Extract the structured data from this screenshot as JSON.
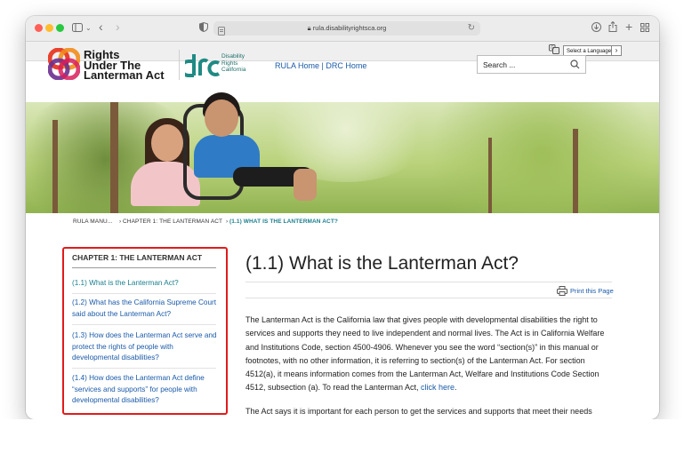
{
  "browser": {
    "url": "rula.disabilityrightsca.org"
  },
  "language_select": {
    "label": "Select a Language"
  },
  "site": {
    "logo_line1": "Rights",
    "logo_line2": "Under The",
    "logo_line3": "Lanterman Act",
    "drc_line1": "Disability",
    "drc_line2": "Rights",
    "drc_line3": "California",
    "nav_rula_home": "RULA Home",
    "nav_separator": "|",
    "nav_drc_home": "DRC Home",
    "search_placeholder": "Search ..."
  },
  "breadcrumb": [
    "RULA MANU...",
    "CHAPTER 1: THE LANTERMAN ACT",
    "(1.1) WHAT IS THE LANTERMAN ACT?"
  ],
  "sidebar": {
    "title": "CHAPTER 1: THE LANTERMAN ACT",
    "items": [
      "(1.1) What is the Lanterman Act?",
      "(1.2) What has the California Supreme Court said about the Lanterman Act?",
      "(1.3) How does the Lanterman Act serve and protect the rights of people with developmental disabilities?",
      "(1.4) How does the Lanterman Act define “services and supports” for people with developmental disabilities?"
    ]
  },
  "main": {
    "title": "(1.1) What is the Lanterman Act?",
    "print_label": "Print this Page",
    "paragraph1": "The Lanterman Act is the California law that gives people with developmental disabilities the right to services and supports they need to live independent and normal lives.  The Act is in California Welfare and Institutions Code, section 4500-4906.  Whenever you see the word “section(s)” in this manual or footnotes, with no other information, it is referring to section(s) of the Lanterman Act.  For section 4512(a), it means information comes from the Lanterman Act, Welfare and Institutions Code Section 4512, subsection (a). To read the Lanterman Act,",
    "paragraph1_link": "click here",
    "paragraph1_end": ".",
    "paragraph2": "The Act says it is important for each person to get the services and supports that meet their needs"
  },
  "colors": {
    "link": "#1a5aa8",
    "active_link": "#1a7f8e",
    "highlight_outline": "#e11b1b"
  }
}
